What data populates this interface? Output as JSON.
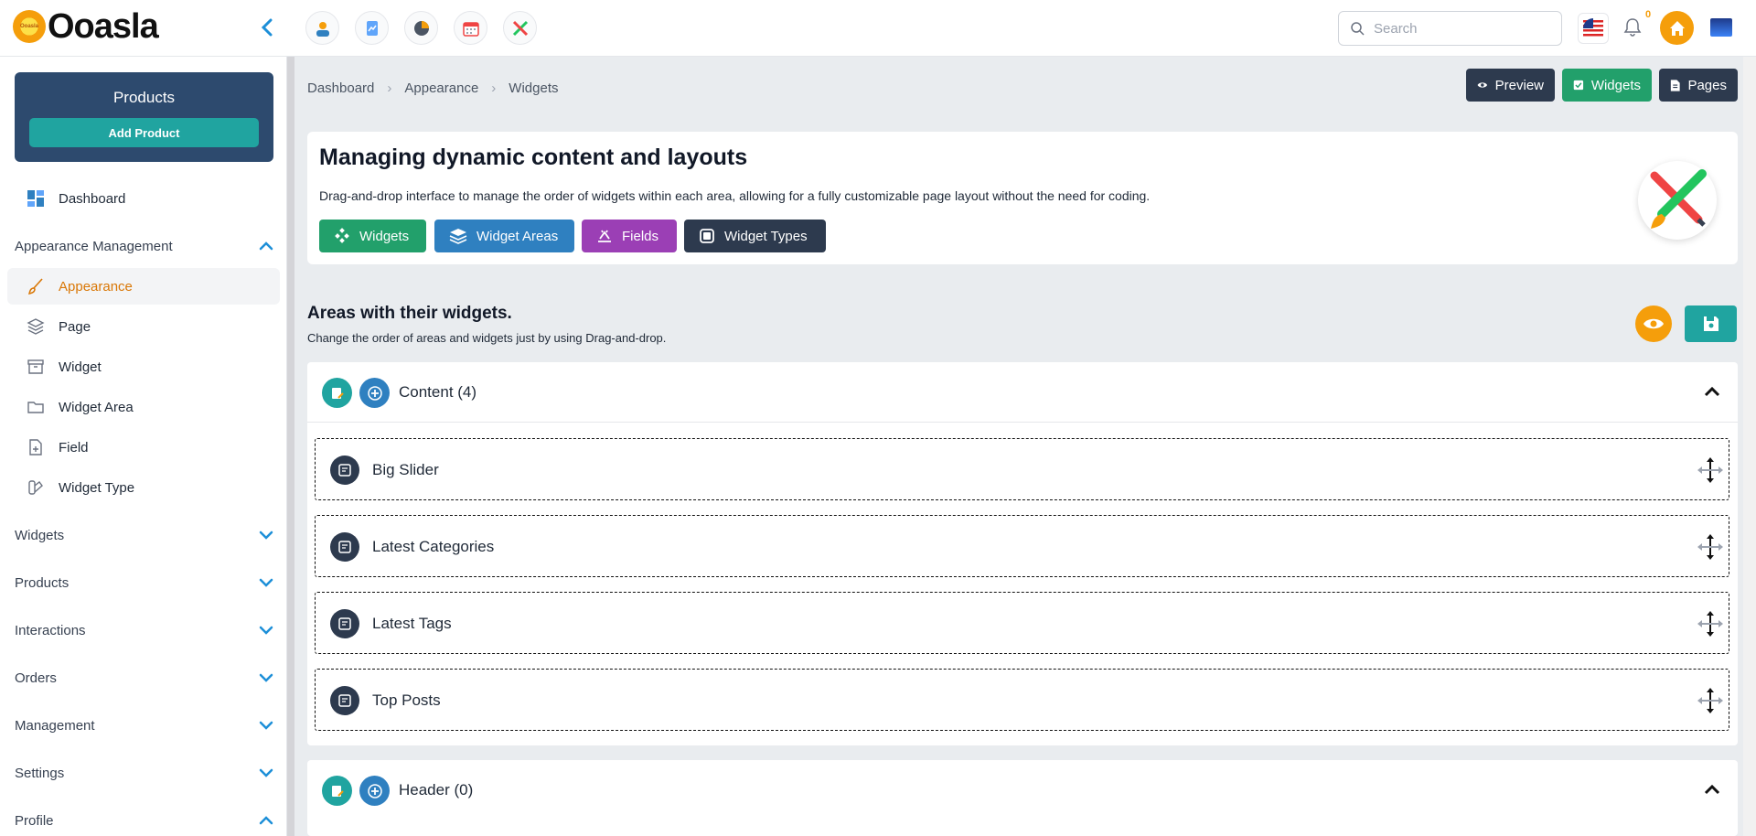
{
  "app": {
    "logo_text": "Ooasla",
    "logo_badge": "Ooasla"
  },
  "header": {
    "search_placeholder": "Search",
    "notification_count": "0"
  },
  "sidebar": {
    "products_card": {
      "title": "Products",
      "add_label": "Add Product"
    },
    "dashboard_label": "Dashboard",
    "appearance_group": "Appearance Management",
    "items": [
      {
        "label": "Appearance"
      },
      {
        "label": "Page"
      },
      {
        "label": "Widget"
      },
      {
        "label": "Widget Area"
      },
      {
        "label": "Field"
      },
      {
        "label": "Widget Type"
      }
    ],
    "groups": [
      {
        "label": "Widgets"
      },
      {
        "label": "Products"
      },
      {
        "label": "Interactions"
      },
      {
        "label": "Orders"
      },
      {
        "label": "Management"
      },
      {
        "label": "Settings"
      },
      {
        "label": "Profile"
      }
    ]
  },
  "breadcrumb": [
    "Dashboard",
    "Appearance",
    "Widgets"
  ],
  "top_actions": {
    "preview": "Preview",
    "widgets": "Widgets",
    "pages": "Pages"
  },
  "hero": {
    "title": "Managing dynamic content and layouts",
    "description": "Drag-and-drop interface to manage the order of widgets within each area, allowing for a fully customizable page layout without the need for coding.",
    "buttons": [
      {
        "label": "Widgets",
        "color": "#22a06b"
      },
      {
        "label": "Widget Areas",
        "color": "#2f80c0"
      },
      {
        "label": "Fields",
        "color": "#9b3fb5"
      },
      {
        "label": "Widget Types",
        "color": "#2d3a4e"
      }
    ]
  },
  "areas_section": {
    "title": "Areas with their widgets.",
    "subtitle": "Change the order of areas and widgets just by using Drag-and-drop."
  },
  "areas": [
    {
      "name": "Content (4)",
      "widgets": [
        "Big Slider",
        "Latest Categories",
        "Latest Tags",
        "Top Posts"
      ]
    },
    {
      "name": "Header (0)",
      "widgets": []
    }
  ],
  "colors": {
    "accent": "#f59e0b",
    "teal": "#20a4a0",
    "dark": "#2d3a4e",
    "active_text": "#d97706"
  }
}
